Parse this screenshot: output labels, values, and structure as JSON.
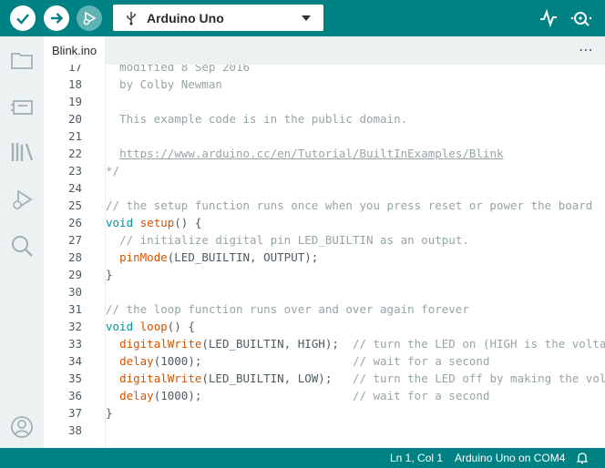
{
  "toolbar": {
    "verify_tooltip": "Verify",
    "upload_tooltip": "Upload",
    "debug_tooltip": "Start Debugging",
    "board_name": "Arduino Uno"
  },
  "tab": {
    "file_name": "Blink.ino",
    "more": "⋯"
  },
  "editor": {
    "lines": [
      {
        "n": "17",
        "text": "  modified 8 Sep 2016"
      },
      {
        "n": "18",
        "text": "  by Colby Newman"
      },
      {
        "n": "19",
        "text": ""
      },
      {
        "n": "20",
        "text": "  This example code is in the public domain."
      },
      {
        "n": "21",
        "text": ""
      },
      {
        "n": "22",
        "text": "  https://www.arduino.cc/en/Tutorial/BuiltInExamples/Blink"
      },
      {
        "n": "23",
        "text": "*/"
      },
      {
        "n": "24",
        "text": ""
      },
      {
        "n": "25",
        "text": "// the setup function runs once when you press reset or power the board"
      },
      {
        "n": "26",
        "text": "void setup() {"
      },
      {
        "n": "27",
        "text": "  // initialize digital pin LED_BUILTIN as an output."
      },
      {
        "n": "28",
        "text": "  pinMode(LED_BUILTIN, OUTPUT);"
      },
      {
        "n": "29",
        "text": "}"
      },
      {
        "n": "30",
        "text": ""
      },
      {
        "n": "31",
        "text": "// the loop function runs over and over again forever"
      },
      {
        "n": "32",
        "text": "void loop() {"
      },
      {
        "n": "33",
        "text": "  digitalWrite(LED_BUILTIN, HIGH);  // turn the LED on (HIGH is the voltage level)"
      },
      {
        "n": "34",
        "text": "  delay(1000);                      // wait for a second"
      },
      {
        "n": "35",
        "text": "  digitalWrite(LED_BUILTIN, LOW);   // turn the LED off by making the voltage LOW"
      },
      {
        "n": "36",
        "text": "  delay(1000);                      // wait for a second"
      },
      {
        "n": "37",
        "text": "}"
      },
      {
        "n": "38",
        "text": ""
      }
    ]
  },
  "status": {
    "cursor": "Ln 1, Col 1",
    "board_port": "Arduino Uno on COM4"
  },
  "colors": {
    "teal": "#008184",
    "keyword": "#00979c",
    "function": "#d35400",
    "comment": "#95a5a6"
  },
  "icons": [
    "verify-icon",
    "upload-icon",
    "debug-icon",
    "usb-icon",
    "serial-plotter-icon",
    "serial-monitor-icon",
    "folder-icon",
    "board-manager-icon",
    "library-icon",
    "debug-sidebar-icon",
    "search-icon",
    "account-icon",
    "bell-icon"
  ]
}
